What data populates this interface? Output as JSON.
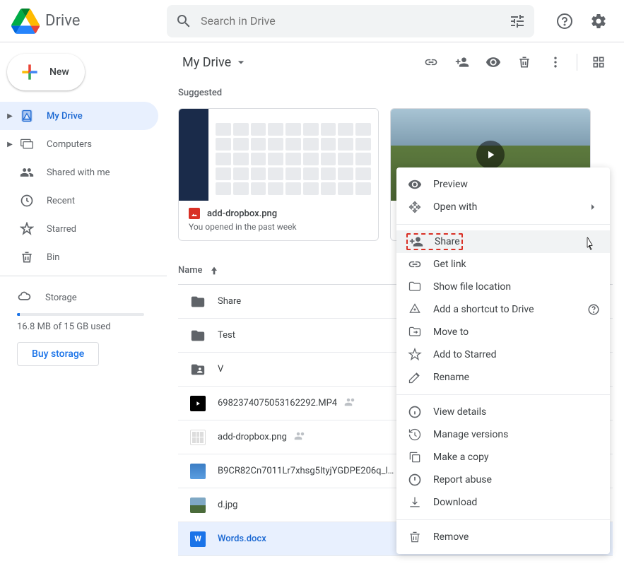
{
  "header": {
    "app_name": "Drive",
    "search_placeholder": "Search in Drive"
  },
  "new_button": "New",
  "nav": {
    "my_drive": "My Drive",
    "computers": "Computers",
    "shared": "Shared with me",
    "recent": "Recent",
    "starred": "Starred",
    "bin": "Bin"
  },
  "storage": {
    "label": "Storage",
    "usage": "16.8 MB of 15 GB used",
    "buy": "Buy storage"
  },
  "breadcrumb": "My Drive",
  "suggested_label": "Suggested",
  "suggested": [
    {
      "title": "add-dropbox.png",
      "subtitle": "You opened in the past week"
    }
  ],
  "columns": {
    "name": "Name"
  },
  "files": [
    {
      "name": "Share",
      "type": "folder"
    },
    {
      "name": "Test",
      "type": "folder"
    },
    {
      "name": "V",
      "type": "folder-shared"
    },
    {
      "name": "6982374075053162292.MP4",
      "type": "video",
      "shared": true
    },
    {
      "name": "add-dropbox.png",
      "type": "image",
      "shared": true
    },
    {
      "name": "B9CR82Cn7011Lr7xhsg5ltyjYGDPE206q_l…",
      "type": "image-sm"
    },
    {
      "name": "d.jpg",
      "type": "image-scenic"
    },
    {
      "name": "Words.docx",
      "type": "word",
      "selected": true
    }
  ],
  "context_menu": {
    "preview": "Preview",
    "open_with": "Open with",
    "share": "Share",
    "get_link": "Get link",
    "show_location": "Show file location",
    "add_shortcut": "Add a shortcut to Drive",
    "move_to": "Move to",
    "add_starred": "Add to Starred",
    "rename": "Rename",
    "view_details": "View details",
    "manage_versions": "Manage versions",
    "make_copy": "Make a copy",
    "report_abuse": "Report abuse",
    "download": "Download",
    "remove": "Remove"
  }
}
